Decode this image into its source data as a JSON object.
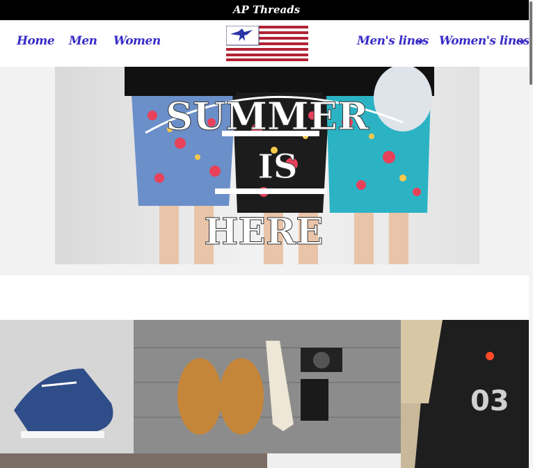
{
  "brand": {
    "name": "AP Threads"
  },
  "nav": {
    "home": "Home",
    "men": "Men",
    "women": "Women",
    "mens_lines": "Men's lines",
    "womens_lines": "Women's lines"
  },
  "hero": {
    "word1": "SUMMER",
    "word2": "IS",
    "word3": "HERE"
  },
  "colors": {
    "nav_link": "#3a2cc8",
    "topbar": "#000000",
    "flag_red": "#b22234",
    "flag_blue": "#3c3b6e"
  },
  "icons": [
    "eagle-flag-logo",
    "caret-down-icon"
  ]
}
